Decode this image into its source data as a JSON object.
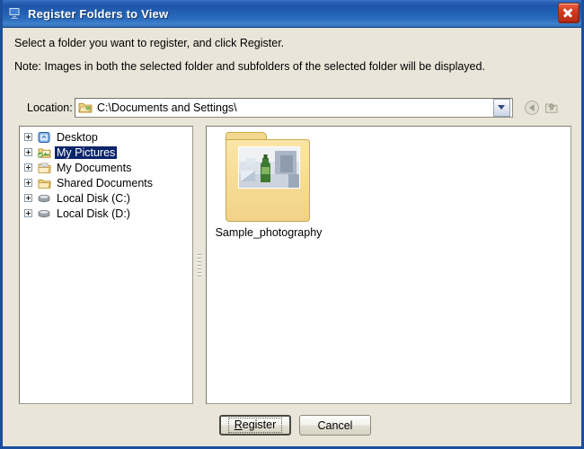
{
  "window": {
    "title": "Register Folders to View",
    "icon": "monitor-folder-icon",
    "close_label": "×",
    "titlebar_color": "#2360b3",
    "body_color": "#e9e5d9"
  },
  "instructions": {
    "line1": "Select a folder you want to register, and click Register.",
    "line2": "Note: Images in both the selected folder and subfolders of the selected folder will be displayed."
  },
  "location": {
    "label": "Location:",
    "value": "C:\\Documents and Settings\\",
    "placeholder": "",
    "icon": "folder-open-icon",
    "dropdown_icon": "chevron-down-icon",
    "back_button": "back-arrow-icon",
    "up_button": "up-folder-icon"
  },
  "tree": {
    "items": [
      {
        "label": "Desktop",
        "icon": "desktop-icon",
        "selected": false,
        "expandable": true
      },
      {
        "label": "My Pictures",
        "icon": "pictures-folder-icon",
        "selected": true,
        "expandable": true
      },
      {
        "label": "My Documents",
        "icon": "documents-folder-icon",
        "selected": false,
        "expandable": true
      },
      {
        "label": "Shared Documents",
        "icon": "shared-folder-icon",
        "selected": false,
        "expandable": true
      },
      {
        "label": "Local Disk (C:)",
        "icon": "hard-disk-icon",
        "selected": false,
        "expandable": true
      },
      {
        "label": "Local Disk (D:)",
        "icon": "hard-disk-icon",
        "selected": false,
        "expandable": true
      }
    ],
    "selection_color": "#0a246a"
  },
  "files": {
    "items": [
      {
        "label": "Sample_photography",
        "icon": "folder-thumbnail-icon"
      }
    ]
  },
  "buttons": {
    "register": "Register",
    "register_accel": "R",
    "register_rest": "egister",
    "cancel": "Cancel"
  }
}
